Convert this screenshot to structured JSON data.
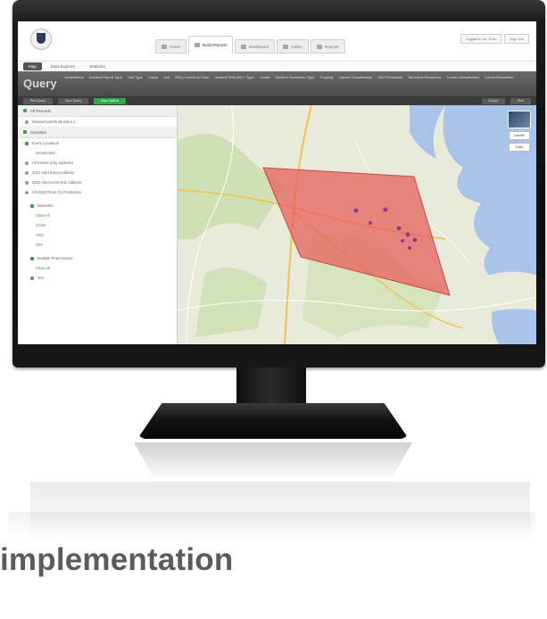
{
  "caption": "implementation",
  "app": {
    "tabs": [
      {
        "label": "Home",
        "active": false
      },
      {
        "label": "Build Reports",
        "active": true
      },
      {
        "label": "Dashboard",
        "active": false
      },
      {
        "label": "Admin",
        "active": false
      },
      {
        "label": "Reports",
        "active": false
      }
    ],
    "user_buttons": [
      "Logged in as: JDoe",
      "Sign Out"
    ],
    "subnav": [
      "Map",
      "Data Explorer",
      "Statistics"
    ],
    "query_title": "Query",
    "filters": [
      "Jurisdictions",
      "Incident Report Type",
      "Unit Type",
      "Cause",
      "Unit",
      "Entry Level/Loc Code",
      "Incident Shift (Dt) + Type",
      "Locate",
      "Incident Resolution Type",
      "Property",
      "Landsc Classification",
      "Unit Prevalence",
      "Structural Resources",
      "Locale Classification",
      "Cohort Resolution"
    ],
    "actions": [
      "Run Query",
      "Save Query",
      "Map Options"
    ],
    "actions_right": [
      "Export",
      "Print"
    ],
    "sidebar": {
      "sections": [
        {
          "title": "All Records",
          "items": [
            "Massachusetts (Boston) 1"
          ]
        },
        {
          "title": "Activities",
          "items": []
        },
        {
          "title": "Event Locations",
          "items": [
            "Geolocated"
          ]
        },
        {
          "title": "",
          "items": [
            "All Events (City address)",
            "2021 Alert Event Address",
            "2022 Alert event Rdc Address",
            "All 2020 Photo On Production"
          ]
        },
        {
          "title": "Networks",
          "items": [
            "Clear All",
            "CASA",
            "CNS",
            "CPA"
          ]
        },
        {
          "title": "Multiple Point Source",
          "items": [
            "Clear All",
            "Yes"
          ]
        }
      ]
    },
    "map": {
      "satellite_label": "Satellite",
      "terrain_label": "Traffic"
    }
  },
  "colors": {
    "polygon_fill": "#e85a57",
    "water": "#a8c4e8",
    "land": "#e8ebd9",
    "highway": "#f2c14e",
    "accent_green": "#47a03d"
  }
}
